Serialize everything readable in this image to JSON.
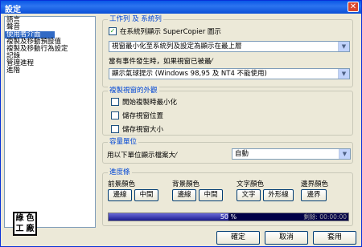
{
  "window": {
    "title": "設定",
    "close_glyph": "✕"
  },
  "sidebar": {
    "items": [
      {
        "label": "語言"
      },
      {
        "label": "聲音"
      },
      {
        "label": "使用者介面"
      },
      {
        "label": "複製及移動預設值"
      },
      {
        "label": "複製及移動行為設定"
      },
      {
        "label": "記錄"
      },
      {
        "label": "管理進程"
      },
      {
        "label": "進階"
      }
    ],
    "selected_index": 2
  },
  "logo": {
    "chars": [
      "綠",
      "色",
      "工",
      "廠"
    ]
  },
  "taskbar_group": {
    "legend": "工作列 及 系統列",
    "show_in_systray": {
      "label": "在系統列顯示 SuperCopier 圖示",
      "checked": true
    },
    "minimize_select": "視窗最小化至系統列及設定為顯示在最上層",
    "event_label": "當有事件發生時，如果視窗已被最⁄",
    "tooltip_select": "顯示氣球提示 (Windows 98,95 及 NT4 不能使用)"
  },
  "copy_window_group": {
    "legend": "複製視窗的外觀",
    "options": [
      {
        "label": "開始複製時最小化",
        "checked": false
      },
      {
        "label": "儲存視窗位置",
        "checked": false
      },
      {
        "label": "儲存視窗大小",
        "checked": false
      }
    ]
  },
  "size_group": {
    "legend": "容量單位",
    "label": "用以下單位顯示檔案大⁄",
    "select": "自動"
  },
  "progress_group": {
    "legend": "進度條",
    "columns": [
      {
        "title": "前景顏色",
        "buttons": [
          "邊線",
          "中間"
        ]
      },
      {
        "title": "背景顏色",
        "buttons": [
          "邊線",
          "中間"
        ]
      },
      {
        "title": "文字顏色",
        "buttons": [
          "文字",
          "外形線"
        ]
      },
      {
        "title": "邊界顏色",
        "buttons": [
          "邊界"
        ]
      }
    ],
    "preview": {
      "percent_text": "50 %",
      "percent_value": 0.5,
      "remaining_text": "剩餘: 00:00:00"
    }
  },
  "footer": {
    "ok": "確定",
    "cancel": "取消",
    "apply": "套用"
  }
}
